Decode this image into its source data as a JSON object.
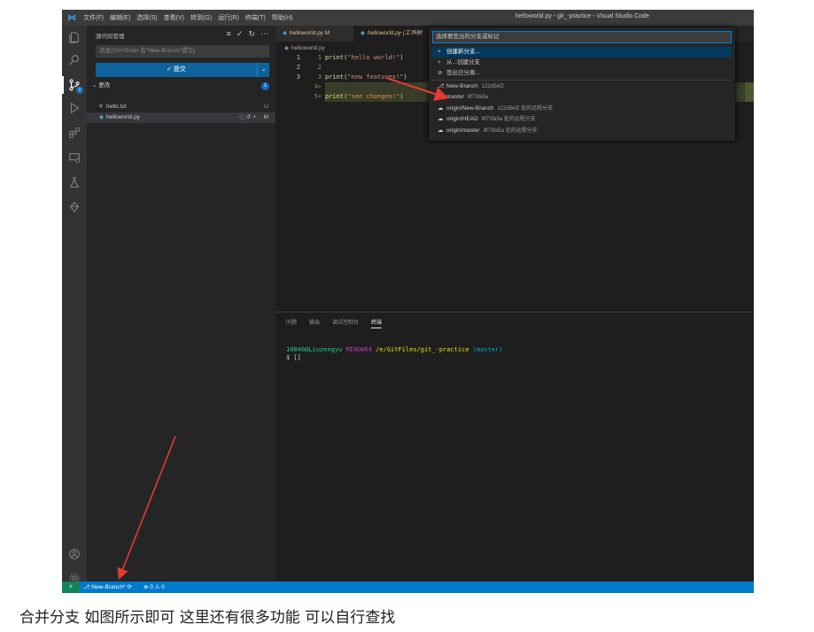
{
  "window": {
    "title": "helloworld.py - git_-practice - Visual Studio Code",
    "menu": [
      "文件(F)",
      "编辑(E)",
      "选择(S)",
      "查看(V)",
      "转到(G)",
      "运行(R)",
      "终端(T)",
      "帮助(H)"
    ]
  },
  "activity_bar": {
    "items": [
      "explorer-icon",
      "search-icon",
      "source-control-icon",
      "run-debug-icon",
      "extensions-icon",
      "remote-explorer-icon",
      "testing-icon",
      "git-graph-icon"
    ],
    "scm_badge": "2",
    "bottom": [
      "account-icon",
      "settings-gear-icon"
    ]
  },
  "sidebar": {
    "title": "源代码管理",
    "message_placeholder": "消息(Ctrl+Enter 在\"New-Branch\"提交)",
    "commit_label": "✓ 提交",
    "changes_label": "更改",
    "changes_count": "1",
    "files": [
      {
        "name": "hello.txt",
        "status": "U"
      },
      {
        "name": "helloworld.py",
        "status": "M"
      }
    ]
  },
  "editor": {
    "tabs": [
      {
        "label": "helloworld.py M"
      },
      {
        "label": "helloworld.py (工作树"
      }
    ],
    "breadcrumb": "helloworld.py",
    "lines": [
      {
        "l": "1",
        "r": "1",
        "pre": "print(",
        "str": "\"hello world!\"",
        "post": ")"
      },
      {
        "l": "2",
        "r": "2",
        "pre": "",
        "str": "",
        "post": ""
      },
      {
        "l": "3",
        "r": "3",
        "pre": "print(",
        "str": "\"new features!\"",
        "post": ")"
      },
      {
        "l": "",
        "r": "4+",
        "pre": "",
        "str": "",
        "post": ""
      },
      {
        "l": "",
        "r": "5+",
        "pre": "print(",
        "str": "\"see changes!\"",
        "post": ")"
      }
    ]
  },
  "quick_pick": {
    "placeholder": "选择要签出的分支或标记",
    "items": [
      {
        "icon": "+",
        "label": "创建新分支...",
        "desc": ""
      },
      {
        "icon": "+",
        "label": "从...创建分支",
        "desc": ""
      },
      {
        "icon": "⊘",
        "label": "签出已分离...",
        "desc": ""
      },
      {
        "icon": "⎇",
        "label": "New-Branch",
        "desc": "122d5ef2"
      },
      {
        "icon": "⎇",
        "label": "master",
        "desc": "8f73fa5a"
      },
      {
        "icon": "☁",
        "label": "origin/New-Branch",
        "desc": "122d5ef2 处的远程分支"
      },
      {
        "icon": "☁",
        "label": "origin/HEAD",
        "desc": "8f73fa5a 处的远程分支"
      },
      {
        "icon": "☁",
        "label": "origin/master",
        "desc": "8f73fa5a 处的远程分支"
      }
    ]
  },
  "panel": {
    "tabs": [
      "问题",
      "输出",
      "调试控制台",
      "终端"
    ],
    "active_tab": "终端",
    "prompt_user": "10840@Liuzengyu",
    "prompt_env": "MINGW64",
    "prompt_path": "/e/GitFiles/git_-practice",
    "prompt_branch": "(master)",
    "prompt_line": "$ []"
  },
  "status_bar": {
    "remote": "⚡",
    "branch": "⎇ New-Branch* ⟳",
    "problems": "⊗ 0 ⚠ 0"
  },
  "caption": "合并分支 如图所示即可 这里还有很多功能 可以自行查找",
  "colors": {
    "accent": "#007acc",
    "arrow": "#e53935"
  }
}
